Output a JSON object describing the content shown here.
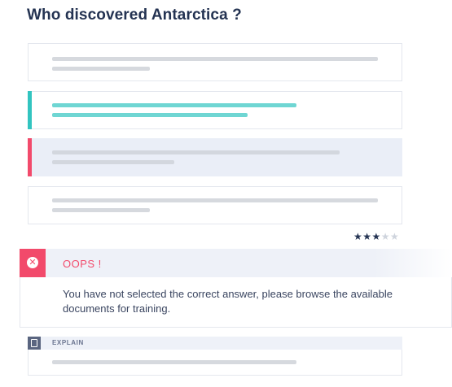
{
  "question": {
    "title": "Who discovered Antarctica ?"
  },
  "options": [
    {
      "state": "default"
    },
    {
      "state": "correct"
    },
    {
      "state": "selected-wrong"
    },
    {
      "state": "default"
    }
  ],
  "rating": {
    "value": 3,
    "max": 5,
    "filled_glyph": "★★★",
    "empty_glyph": "★★"
  },
  "alert": {
    "icon": "close-circle-icon",
    "title": "OOPS !",
    "message": "You have not selected the correct answer, please browse the available documents for training.",
    "color": "#f24a6b"
  },
  "explain": {
    "icon": "map-icon",
    "label": "EXPLAIN"
  },
  "colors": {
    "correct": "#32c4c0",
    "wrong": "#f24a6b",
    "title": "#243352"
  }
}
